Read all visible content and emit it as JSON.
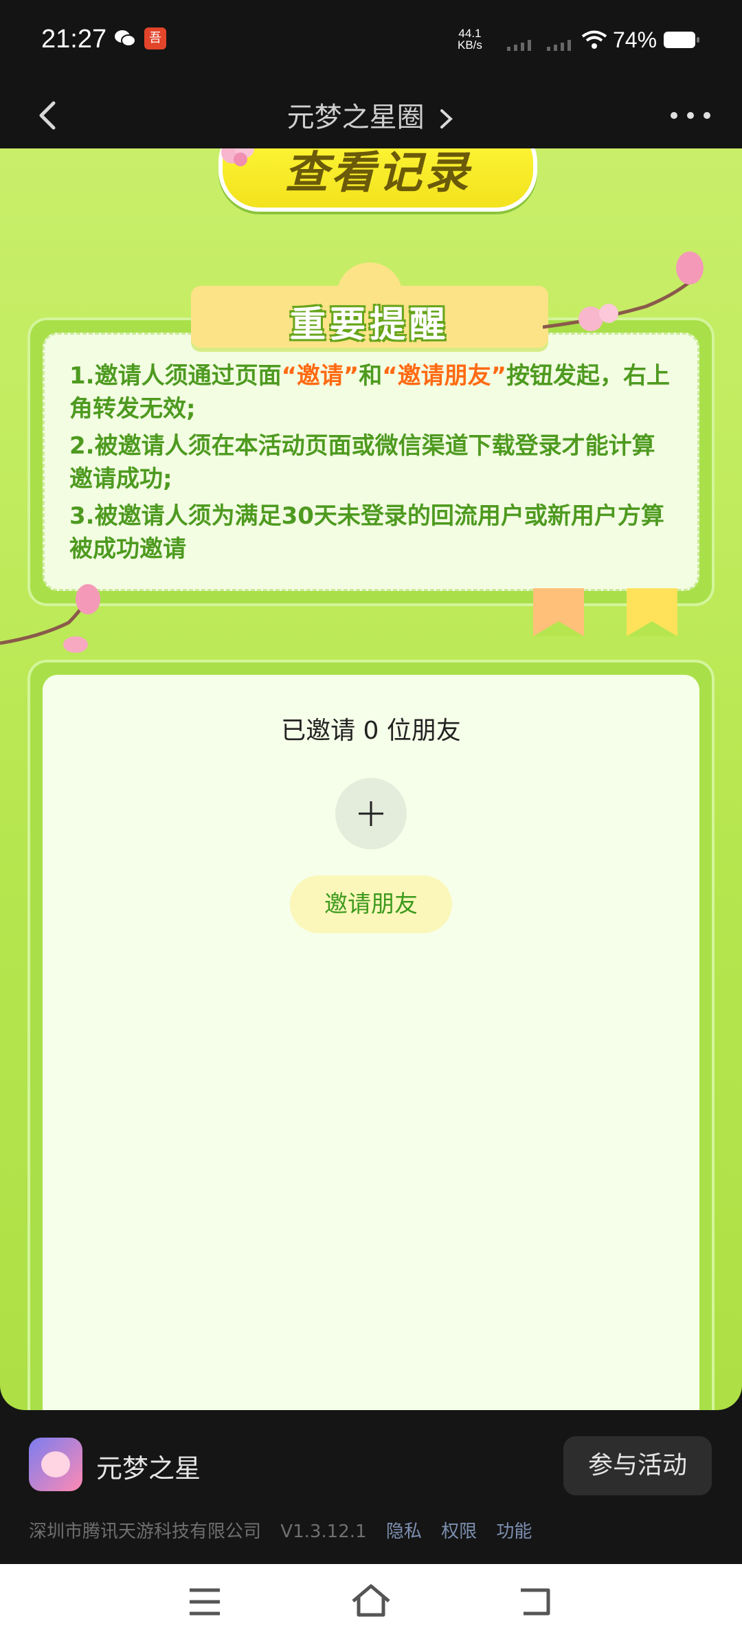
{
  "status_bar": {
    "time": "21:27",
    "net_speed_value": "44.1",
    "net_speed_unit": "KB/s",
    "battery": "74%",
    "app_icon_text": "吾"
  },
  "nav": {
    "title": "元梦之星圈"
  },
  "record_button": {
    "label": "查看记录"
  },
  "reminder": {
    "title": "重要提醒",
    "items": [
      {
        "prefix": "1.邀请人须通过页面",
        "q1": "“邀请”",
        "mid": "和",
        "q2": "“邀请朋友”",
        "suffix": "按钮发起，右上角转发无效;"
      },
      {
        "text": "2.被邀请人须在本活动页面或微信渠道下载登录才能计算邀请成功;"
      },
      {
        "text": "3.被邀请人须为满足30天未登录的回流用户或新用户方算被成功邀请"
      }
    ]
  },
  "invite": {
    "count_text": "已邀请 0 位朋友",
    "button_label": "邀请朋友"
  },
  "bottom_bar": {
    "app_name": "元梦之星",
    "join_button": "参与活动",
    "company": "深圳市腾讯天游科技有限公司",
    "version": "V1.3.12.1",
    "links": [
      "隐私",
      "权限",
      "功能"
    ]
  },
  "colors": {
    "background_green": "#b6e64f",
    "highlight_orange": "#ff6a13",
    "text_green": "#4e9a20"
  }
}
